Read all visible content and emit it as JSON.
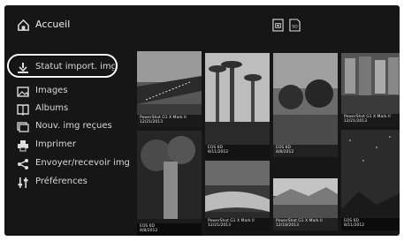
{
  "header": {
    "title": "Accueil",
    "icons": [
      "home-icon",
      "camera-card-icon",
      "sd-card-icon"
    ],
    "sd_label": "SD"
  },
  "sidebar": {
    "items": [
      {
        "label": "Statut import. img",
        "icon": "import-status-icon"
      },
      {
        "label": "Images",
        "icon": "images-icon"
      },
      {
        "label": "Albums",
        "icon": "albums-icon"
      },
      {
        "label": "Nouv. img reçues",
        "icon": "received-images-icon"
      },
      {
        "label": "Imprimer",
        "icon": "printer-icon"
      },
      {
        "label": "Envoyer/recevoir img",
        "icon": "share-icon"
      },
      {
        "label": "Préférences",
        "icon": "preferences-icon"
      }
    ]
  },
  "thumbnails": [
    {
      "camera": "PowerShot G1 X Mark II",
      "date": "12/21/2013"
    },
    {
      "camera": "EOS 6D",
      "date": "8/8/2012"
    },
    {
      "camera": "EOS 6D",
      "date": "8/11/2012"
    },
    {
      "camera": "PowerShot G1 X Mark II",
      "date": "12/21/2013"
    },
    {
      "camera": "EOS 6D",
      "date": "8/8/2012"
    },
    {
      "camera": "PowerShot G1 X Mark II",
      "date": "12/21/2013"
    },
    {
      "camera": "PowerShot G1 X Mark II",
      "date": "12/18/2013"
    },
    {
      "camera": "EOS 6D",
      "date": "8/11/2012"
    }
  ],
  "colors": {
    "background": "#161616",
    "text": "#d8d8d8",
    "highlight": "#ffffff"
  }
}
